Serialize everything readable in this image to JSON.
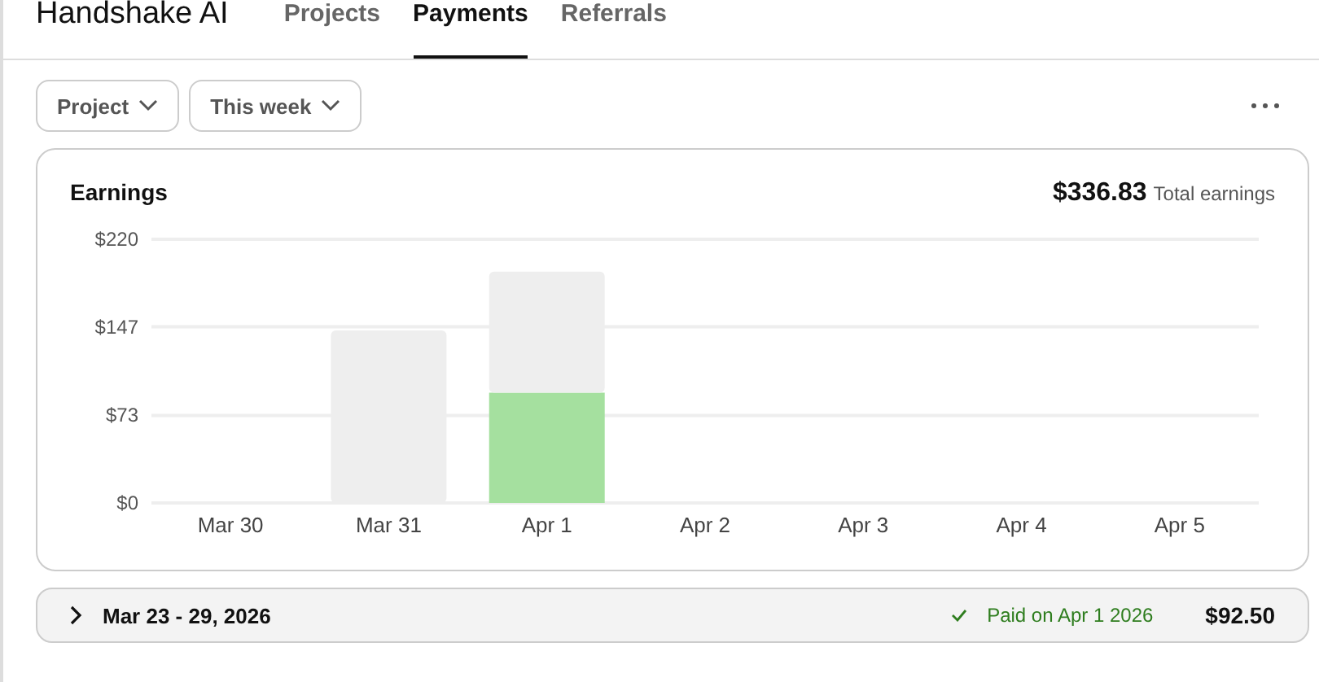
{
  "header": {
    "brand": "Handshake AI",
    "tabs": [
      {
        "label": "Projects",
        "selected": false
      },
      {
        "label": "Payments",
        "selected": true
      },
      {
        "label": "Referrals",
        "selected": false
      }
    ]
  },
  "filters": [
    {
      "label": "Project"
    },
    {
      "label": "This week"
    }
  ],
  "earnings": {
    "title": "Earnings",
    "total": "$336.83",
    "total_label": "Total earnings",
    "chart_data": {
      "type": "bar",
      "stacked": true,
      "categories": [
        "Mar 30",
        "Mar 31",
        "Apr 1",
        "Apr 2",
        "Apr 3",
        "Apr 4",
        "Apr 5"
      ],
      "ylim": [
        0,
        220
      ],
      "yticks": [
        {
          "value": 0,
          "label": "$0"
        },
        {
          "value": 73,
          "label": "$73"
        },
        {
          "value": 147,
          "label": "$147"
        },
        {
          "value": 220,
          "label": "$220"
        }
      ],
      "series": [
        {
          "color": "#a5e09f",
          "values": [
            0,
            0,
            92,
            0,
            0,
            0,
            0
          ]
        },
        {
          "color": "#eeeeee",
          "values": [
            0,
            144,
            101,
            0,
            0,
            0,
            0
          ]
        }
      ]
    }
  },
  "payouts": [
    {
      "period": "Mar 23 - 29, 2026",
      "status": "Paid on Apr 1 2026",
      "amount": "$92.50",
      "expanded": false
    }
  ]
}
